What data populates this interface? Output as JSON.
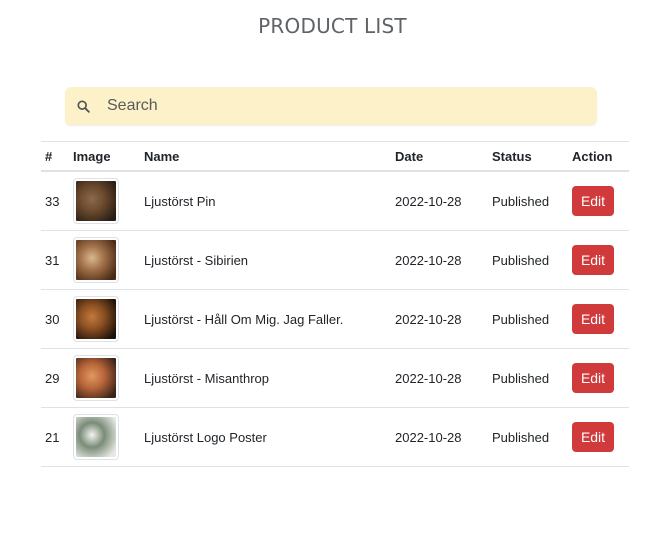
{
  "header": {
    "title": "PRODUCT LIST"
  },
  "search": {
    "placeholder": "Search",
    "value": "",
    "icon": "search-icon"
  },
  "table": {
    "columns": [
      "#",
      "Image",
      "Name",
      "Date",
      "Status",
      "Action"
    ],
    "rows": [
      {
        "id": "33",
        "name": "Ljustörst Pin",
        "date": "2022-10-28",
        "status": "Published",
        "action": "Edit",
        "thumb_colors": [
          "#2a1d14",
          "#6b4a2e",
          "#8a6a4a"
        ]
      },
      {
        "id": "31",
        "name": "Ljustörst - Sibirien",
        "date": "2022-10-28",
        "status": "Published",
        "action": "Edit",
        "thumb_colors": [
          "#4a2a16",
          "#a07048",
          "#d8b890"
        ]
      },
      {
        "id": "30",
        "name": "Ljustörst - Håll Om Mig. Jag Faller.",
        "date": "2022-10-28",
        "status": "Published",
        "action": "Edit",
        "thumb_colors": [
          "#1e120a",
          "#8a4f22",
          "#c27a3c"
        ]
      },
      {
        "id": "29",
        "name": "Ljustörst - Misanthrop",
        "date": "2022-10-28",
        "status": "Published",
        "action": "Edit",
        "thumb_colors": [
          "#3a2418",
          "#b8653a",
          "#e09a60"
        ]
      },
      {
        "id": "21",
        "name": "Ljustörst Logo Poster",
        "date": "2022-10-28",
        "status": "Published",
        "action": "Edit",
        "thumb_colors": [
          "#e6e8e4",
          "#7a8c78",
          "#f4f4f0"
        ]
      }
    ]
  },
  "colors": {
    "title": "#5f6368",
    "search_bg": "#fcf1c8",
    "edit_button": "#d03a3a",
    "border": "#dee2e6"
  }
}
